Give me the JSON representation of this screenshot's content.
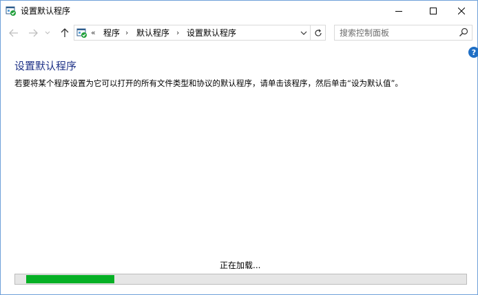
{
  "window": {
    "title": "设置默认程序",
    "icon": "default-programs-icon"
  },
  "nav": {
    "back_icon": "arrow-left-icon",
    "forward_icon": "arrow-right-icon",
    "recent_icon": "chevron-down-icon",
    "up_icon": "arrow-up-icon"
  },
  "address": {
    "overflow": "«",
    "crumbs": [
      "程序",
      "默认程序",
      "设置默认程序"
    ],
    "separator": "›"
  },
  "search": {
    "placeholder": "搜索控制面板",
    "value": ""
  },
  "help": {
    "label": "?"
  },
  "content": {
    "title": "设置默认程序",
    "description": "若要将某个程序设置为它可以打开的所有文件类型和协议的默认程序，请单击该程序，然后单击“设为默认值”。",
    "loading": "正在加载..."
  },
  "progress": {
    "offset": 0.025,
    "fraction": 0.195,
    "color": "#06b025"
  },
  "colors": {
    "title": "#1e3287",
    "accent": "#1f6fc5"
  }
}
